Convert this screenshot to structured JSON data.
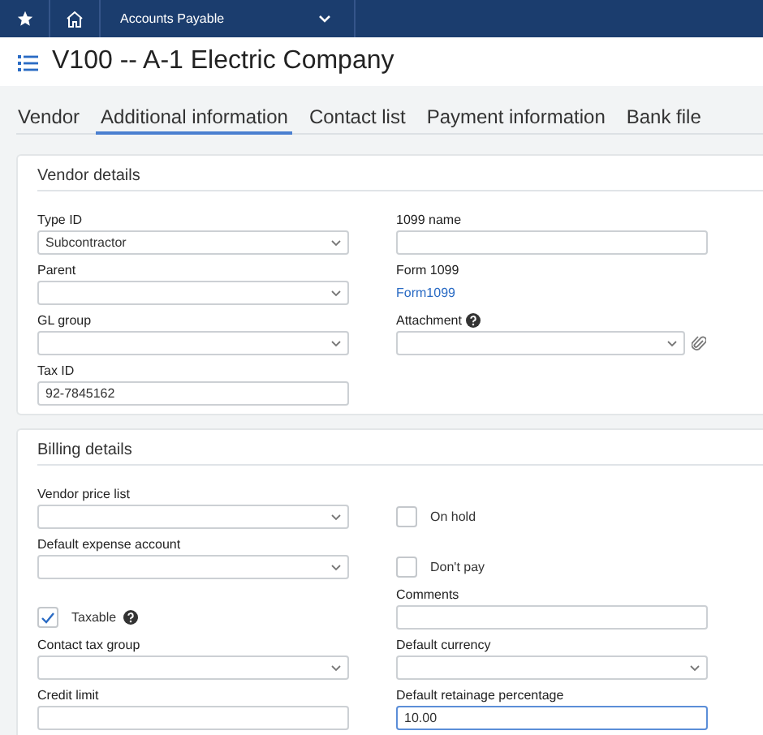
{
  "topbar": {
    "module": "Accounts Payable"
  },
  "title": "V100 -- A-1 Electric Company",
  "tabs": [
    {
      "label": "Vendor",
      "selected": false
    },
    {
      "label": "Additional information",
      "selected": true
    },
    {
      "label": "Contact list",
      "selected": false
    },
    {
      "label": "Payment information",
      "selected": false
    },
    {
      "label": "Bank file",
      "selected": false
    }
  ],
  "sections": [
    {
      "title": "Vendor details",
      "columns": [
        [
          {
            "kind": "select",
            "label": "Type ID",
            "value": "Subcontractor"
          },
          {
            "kind": "select",
            "label": "Parent"
          },
          {
            "kind": "select",
            "label": "GL group"
          },
          {
            "kind": "text",
            "label": "Tax ID",
            "value": "92-7845162"
          }
        ],
        [
          {
            "kind": "text",
            "label": "1099 name"
          },
          {
            "kind": "link",
            "label": "Form 1099",
            "value": "Form1099"
          },
          {
            "kind": "attachment",
            "label": "Attachment",
            "help": true
          }
        ]
      ]
    },
    {
      "title": "Billing details",
      "columns": [
        [
          {
            "kind": "select",
            "label": "Vendor price list"
          },
          {
            "kind": "select",
            "label": "Default expense account"
          },
          {
            "kind": "checkbox",
            "label": "Taxable",
            "checked": true,
            "help": true
          },
          {
            "kind": "select",
            "label": "Contact tax group"
          },
          {
            "kind": "text",
            "label": "Credit limit"
          }
        ],
        [
          {
            "kind": "checkbox",
            "label": "On hold",
            "checked": false
          },
          {
            "kind": "checkbox",
            "label": "Don't pay",
            "checked": false
          },
          {
            "kind": "text",
            "label": "Comments"
          },
          {
            "kind": "select",
            "label": "Default currency"
          },
          {
            "kind": "text",
            "label": "Default retainage percentage",
            "value": "10.00",
            "focused": true
          }
        ]
      ]
    }
  ]
}
